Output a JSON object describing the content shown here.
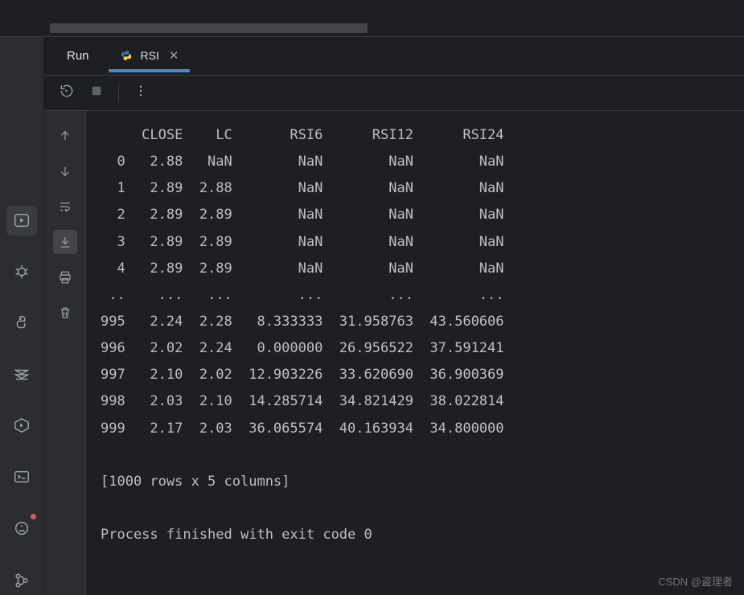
{
  "tabbar": {
    "run_label": "Run",
    "file_name": "RSI"
  },
  "chart_data": {
    "type": "table",
    "title": "DataFrame output",
    "columns": [
      "",
      "CLOSE",
      "LC",
      "RSI6",
      "RSI12",
      "RSI24"
    ],
    "rows": [
      [
        "0",
        "2.88",
        "NaN",
        "NaN",
        "NaN",
        "NaN"
      ],
      [
        "1",
        "2.89",
        "2.88",
        "NaN",
        "NaN",
        "NaN"
      ],
      [
        "2",
        "2.89",
        "2.89",
        "NaN",
        "NaN",
        "NaN"
      ],
      [
        "3",
        "2.89",
        "2.89",
        "NaN",
        "NaN",
        "NaN"
      ],
      [
        "4",
        "2.89",
        "2.89",
        "NaN",
        "NaN",
        "NaN"
      ],
      [
        "..",
        "...",
        "...",
        "...",
        "...",
        "..."
      ],
      [
        "995",
        "2.24",
        "2.28",
        "8.333333",
        "31.958763",
        "43.560606"
      ],
      [
        "996",
        "2.02",
        "2.24",
        "0.000000",
        "26.956522",
        "37.591241"
      ],
      [
        "997",
        "2.10",
        "2.02",
        "12.903226",
        "33.620690",
        "36.900369"
      ],
      [
        "998",
        "2.03",
        "2.10",
        "14.285714",
        "34.821429",
        "38.022814"
      ],
      [
        "999",
        "2.17",
        "2.03",
        "36.065574",
        "40.163934",
        "34.800000"
      ]
    ],
    "summary": "[1000 rows x 5 columns]"
  },
  "console": {
    "exit_msg": "Process finished with exit code 0"
  },
  "watermark": "CSDN @盗理者"
}
